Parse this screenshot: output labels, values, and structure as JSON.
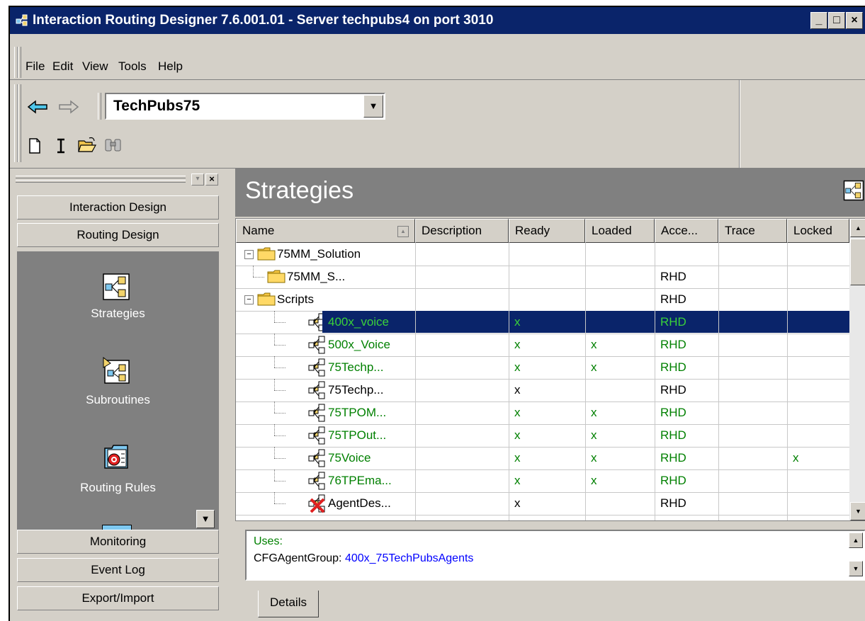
{
  "window": {
    "title": "Interaction Routing Designer  7.6.001.01  - Server techpubs4 on port 3010",
    "controls": [
      "_",
      "□",
      "×"
    ]
  },
  "menu": [
    "File",
    "Edit",
    "View",
    "Tools",
    "Help"
  ],
  "toolbar": {
    "combo_value": "TechPubs75",
    "icons": [
      "back-arrow-icon",
      "forward-arrow-icon",
      "new-document-icon",
      "text-cursor-icon",
      "open-folder-icon",
      "binoculars-icon"
    ]
  },
  "sidebar": {
    "top_buttons": [
      "Interaction Design",
      "Routing Design"
    ],
    "panel_items": [
      {
        "label": "Strategies",
        "icon": "strategy-icon"
      },
      {
        "label": "Subroutines",
        "icon": "subroutine-icon"
      },
      {
        "label": "Routing Rules",
        "icon": "routing-rules-icon"
      }
    ],
    "bottom_buttons": [
      "Monitoring",
      "Event Log",
      "Export/Import"
    ]
  },
  "main": {
    "title": "Strategies",
    "columns": [
      "Name",
      "Description",
      "Ready",
      "Loaded",
      "Acce...",
      "Trace",
      "Locked"
    ],
    "rows": [
      {
        "name": "75MM_Solution",
        "kind": "folder-expanded",
        "ready": "",
        "loaded": "",
        "access": "",
        "trace": "",
        "locked": "",
        "green": false,
        "selected": false
      },
      {
        "name": "75MM_S...",
        "kind": "folder",
        "ready": "",
        "loaded": "",
        "access": "RHD",
        "trace": "",
        "locked": "",
        "green": false,
        "selected": false
      },
      {
        "name": "Scripts",
        "kind": "folder-expanded",
        "ready": "",
        "loaded": "",
        "access": "RHD",
        "trace": "",
        "locked": "",
        "green": false,
        "selected": false
      },
      {
        "name": "400x_voice",
        "kind": "strategy",
        "ready": "x",
        "loaded": "",
        "access": "RHD",
        "trace": "",
        "locked": "",
        "green": true,
        "selected": true
      },
      {
        "name": "500x_Voice",
        "kind": "strategy",
        "ready": "x",
        "loaded": "x",
        "access": "RHD",
        "trace": "",
        "locked": "",
        "green": true,
        "selected": false
      },
      {
        "name": "75Techp...",
        "kind": "strategy",
        "ready": "x",
        "loaded": "x",
        "access": "RHD",
        "trace": "",
        "locked": "",
        "green": true,
        "selected": false
      },
      {
        "name": "75Techp...",
        "kind": "strategy",
        "ready": "x",
        "loaded": "",
        "access": "RHD",
        "trace": "",
        "locked": "",
        "green": false,
        "selected": false
      },
      {
        "name": "75TPOM...",
        "kind": "strategy",
        "ready": "x",
        "loaded": "x",
        "access": "RHD",
        "trace": "",
        "locked": "",
        "green": true,
        "selected": false
      },
      {
        "name": "75TPOut...",
        "kind": "strategy",
        "ready": "x",
        "loaded": "x",
        "access": "RHD",
        "trace": "",
        "locked": "",
        "green": true,
        "selected": false
      },
      {
        "name": "75Voice",
        "kind": "strategy",
        "ready": "x",
        "loaded": "x",
        "access": "RHD",
        "trace": "",
        "locked": "x",
        "green": true,
        "selected": false
      },
      {
        "name": "76TPEma...",
        "kind": "strategy",
        "ready": "x",
        "loaded": "x",
        "access": "RHD",
        "trace": "",
        "locked": "",
        "green": true,
        "selected": false
      },
      {
        "name": "AgentDes...",
        "kind": "strategy-error",
        "ready": "x",
        "loaded": "",
        "access": "RHD",
        "trace": "",
        "locked": "",
        "green": false,
        "selected": false
      }
    ]
  },
  "details": {
    "uses_label": "Uses:",
    "item_prefix": "CFGAgentGroup: ",
    "item_link": "400x_75TechPubsAgents",
    "tab": "Details"
  },
  "colors": {
    "title_bar": "#0a246a",
    "selection": "#0a246a",
    "green_text": "#008000",
    "link": "#0000ff",
    "panel": "#808080"
  }
}
